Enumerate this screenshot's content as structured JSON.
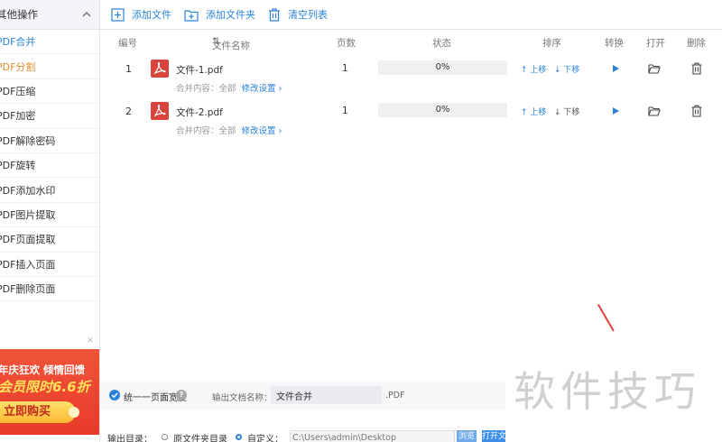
{
  "sidebar": {
    "header": "其他操作",
    "items": [
      {
        "label": "PDF合并",
        "state": "active"
      },
      {
        "label": "PDF分割",
        "state": "orange"
      },
      {
        "label": "PDF压缩",
        "state": ""
      },
      {
        "label": "PDF加密",
        "state": ""
      },
      {
        "label": "PDF解除密码",
        "state": ""
      },
      {
        "label": "PDF旋转",
        "state": ""
      },
      {
        "label": "PDF添加水印",
        "state": ""
      },
      {
        "label": "PDF图片提取",
        "state": ""
      },
      {
        "label": "PDF页面提取",
        "state": ""
      },
      {
        "label": "PDF插入页面",
        "state": ""
      },
      {
        "label": "PDF删除页面",
        "state": ""
      }
    ],
    "promo": {
      "line1": "年庆狂欢 倾情回馈",
      "line2": "会员限时6.6折",
      "button": "立即购买"
    }
  },
  "toolbar": {
    "add_file": "添加文件",
    "add_folder": "添加文件夹",
    "clear_list": "清空列表"
  },
  "table": {
    "headers": {
      "index": "编号",
      "name": "文件名称",
      "pages": "页数",
      "status": "状态",
      "sort": "排序",
      "convert": "转换",
      "open": "打开",
      "delete": "删除"
    },
    "rows": [
      {
        "index": "1",
        "name": "文件-1.pdf",
        "pages": "1",
        "progress": 0,
        "progress_label": "0%",
        "merge_label": "合并内容：全部",
        "modify": "修改设置",
        "up": "上移",
        "down": "下移",
        "down_active": true
      },
      {
        "index": "2",
        "name": "文件-2.pdf",
        "pages": "1",
        "progress": 0,
        "progress_label": "0%",
        "merge_label": "合并内容：全部",
        "modify": "修改设置",
        "up": "上移",
        "down": "下移",
        "down_active": false
      }
    ]
  },
  "options": {
    "uniform_width_label": "统一一页面宽度",
    "uniform_width_checked": true,
    "output_name_label": "输出文档名称：",
    "output_name_value": "文件合并",
    "extension": ".PDF",
    "output_dir_label": "输出目录：",
    "radio_source": "原文件夹目录",
    "radio_custom": "自定义：",
    "selected_radio": "custom",
    "path_value": "C:\\Users\\admin\\Desktop",
    "browse": "浏览",
    "open_folder": "打开文"
  },
  "watermark": "软件技巧",
  "colors": {
    "accent": "#2b82d9",
    "pdf_red": "#d9443c",
    "promo_red": "#e83a2a"
  }
}
